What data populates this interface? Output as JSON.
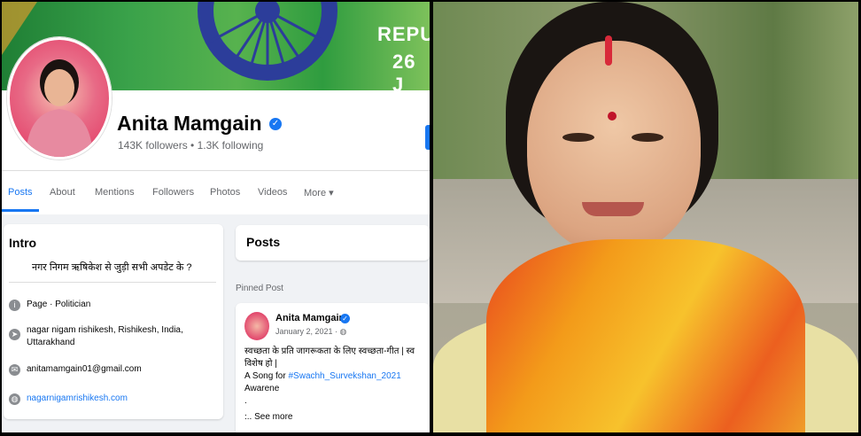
{
  "cover": {
    "text_line1": "REPU",
    "text_line2": "26 J"
  },
  "profile": {
    "name": "Anita Mamgain",
    "stats": "143K followers • 1.3K following"
  },
  "tabs": [
    "Posts",
    "About",
    "Mentions",
    "Followers",
    "Photos",
    "Videos",
    "More ▾"
  ],
  "intro": {
    "title": "Intro",
    "bio": "नगर निगम ऋषिकेश से जुड़ी सभी अपडेट के ?",
    "rows": [
      {
        "icon": "info-icon",
        "text": "Page · Politician"
      },
      {
        "icon": "location-icon",
        "text": "nagar nigam rishikesh, Rishikesh, India, Uttarakhand"
      },
      {
        "icon": "email-icon",
        "text": "anitamamgain01@gmail.com"
      },
      {
        "icon": "globe-icon",
        "text": "nagarnigamrishikesh.com"
      }
    ]
  },
  "posts": {
    "title": "Posts",
    "pinned_label": "Pinned Post",
    "author": "Anita Mamgain",
    "date": "January 2, 2021 · ",
    "line1": "स्वच्छता के प्रति जागरूकता के लिए स्वच्छता-गीत |  स्व",
    "line2": "विशेष हो |",
    "line3_prefix": "A Song for ",
    "hashtag": "#Swachh_Survekshan_2021",
    "line3_suffix": " Awarene",
    "dot1": ".",
    "dot2": ".",
    "see_more": "... See more"
  }
}
